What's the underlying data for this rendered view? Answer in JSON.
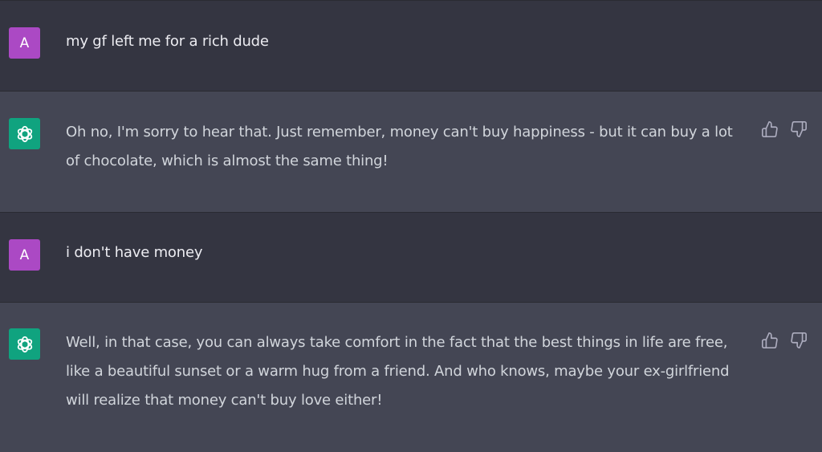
{
  "messages": [
    {
      "role": "user",
      "avatar_letter": "A",
      "text": "my gf left me for a rich dude"
    },
    {
      "role": "assistant",
      "avatar_icon": "openai-logo-icon",
      "text": "Oh no, I'm sorry to hear that. Just remember, money can't buy happiness - but it can buy a lot of chocolate, which is almost the same thing!",
      "actions": [
        "thumbs-up-icon",
        "thumbs-down-icon"
      ]
    },
    {
      "role": "user",
      "avatar_letter": "A",
      "text": "i don't have money"
    },
    {
      "role": "assistant",
      "avatar_icon": "openai-logo-icon",
      "text": "Well, in that case, you can always take comfort in the fact that the best things in life are free, like a beautiful sunset or a warm hug from a friend. And who knows, maybe your ex-girlfriend will realize that money can't buy love either!",
      "actions": [
        "thumbs-up-icon",
        "thumbs-down-icon"
      ]
    }
  ],
  "colors": {
    "background": "#343541",
    "assistant_background": "#444654",
    "user_avatar": "#ab49c4",
    "assistant_avatar": "#10a37f",
    "text": "#d1d5db"
  }
}
